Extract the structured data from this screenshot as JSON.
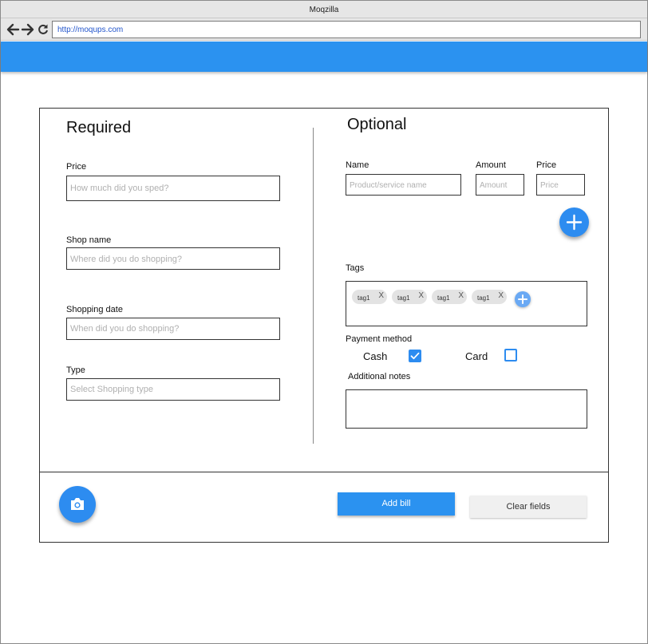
{
  "window": {
    "title": "Moqzilla",
    "url": "http://moqups.com"
  },
  "colors": {
    "accent": "#2b92f0",
    "fab": "#2d8cf0"
  },
  "required": {
    "heading": "Required",
    "price": {
      "label": "Price",
      "placeholder": "How much did you sped?"
    },
    "shop_name": {
      "label": "Shop name",
      "placeholder": "Where did you do shopping?"
    },
    "shopping_date": {
      "label": "Shopping date",
      "placeholder": "When did you do shopping?"
    },
    "type": {
      "label": "Type",
      "placeholder": "Select Shopping type"
    }
  },
  "optional": {
    "heading": "Optional",
    "item": {
      "name": {
        "label": "Name",
        "placeholder": "Product/service name"
      },
      "amount": {
        "label": "Amount",
        "placeholder": "Amount"
      },
      "price": {
        "label": "Price",
        "placeholder": "Price"
      }
    },
    "tags": {
      "label": "Tags",
      "items": [
        {
          "text": "tag1",
          "remove": "X"
        },
        {
          "text": "tag1",
          "remove": "X"
        },
        {
          "text": "tag1",
          "remove": "X"
        },
        {
          "text": "tag1",
          "remove": "X"
        }
      ]
    },
    "payment": {
      "label": "Payment method",
      "cash": {
        "label": "Cash",
        "checked": true
      },
      "card": {
        "label": "Card",
        "checked": false
      }
    },
    "notes": {
      "label": "Additional notes"
    }
  },
  "actions": {
    "add_bill": "Add bill",
    "clear_fields": "Clear fields"
  },
  "icons": {
    "back": "arrow-left-icon",
    "forward": "arrow-right-icon",
    "reload": "reload-icon",
    "add": "plus-icon",
    "camera": "camera-icon"
  }
}
